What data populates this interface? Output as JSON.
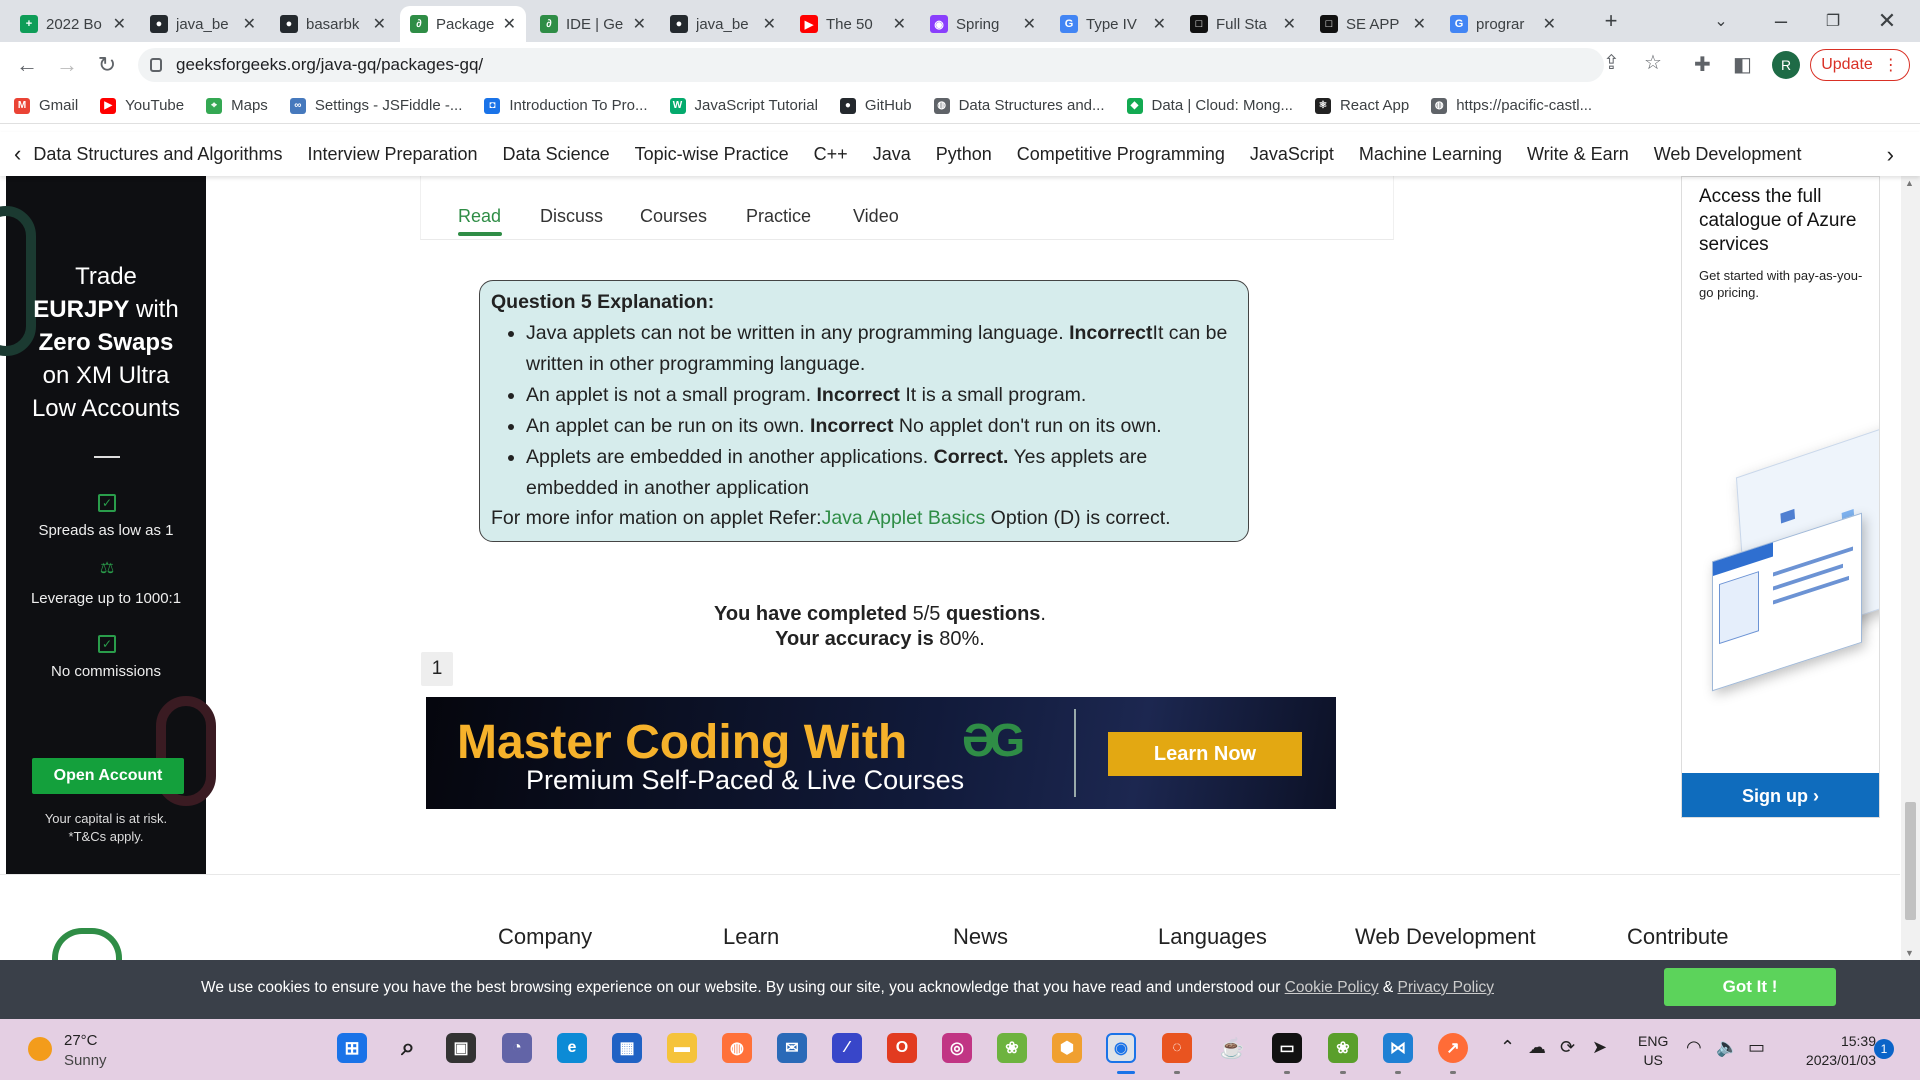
{
  "browser": {
    "tabs": [
      {
        "label": "2022 Bo",
        "icon": "sheets-icon",
        "color": "#0f9d58",
        "glyph": "+"
      },
      {
        "label": "java_be",
        "icon": "github-icon",
        "color": "#24292e",
        "glyph": "●"
      },
      {
        "label": "basarbk",
        "icon": "github-icon",
        "color": "#24292e",
        "glyph": "●"
      },
      {
        "label": "Package",
        "icon": "gfg-icon",
        "color": "#2f8d46",
        "glyph": "∂"
      },
      {
        "label": "IDE | Ge",
        "icon": "gfg-icon",
        "color": "#2f8d46",
        "glyph": "∂"
      },
      {
        "label": "java_be",
        "icon": "github-icon",
        "color": "#24292e",
        "glyph": "●"
      },
      {
        "label": "The 50",
        "icon": "youtube-icon",
        "color": "#ff0000",
        "glyph": "▶"
      },
      {
        "label": "Spring",
        "icon": "spring-icon",
        "color": "#8a3ffc",
        "glyph": "◉"
      },
      {
        "label": "Type IV",
        "icon": "google-icon",
        "color": "#4285f4",
        "glyph": "G"
      },
      {
        "label": "Full Sta",
        "icon": "app-icon",
        "color": "#111111",
        "glyph": "□"
      },
      {
        "label": "SE APP",
        "icon": "app-icon",
        "color": "#111111",
        "glyph": "□"
      },
      {
        "label": "prograr",
        "icon": "google-icon",
        "color": "#4285f4",
        "glyph": "G"
      }
    ],
    "active_tab_index": 3,
    "url": "geeksforgeeks.org/java-gq/packages-gq/",
    "update_label": "Update",
    "profile_initial": "R"
  },
  "bookmarks": [
    {
      "label": "Gmail",
      "icon": "gmail-icon",
      "color": "#ea4335",
      "glyph": "M"
    },
    {
      "label": "YouTube",
      "icon": "youtube-icon",
      "color": "#ff0000",
      "glyph": "▶"
    },
    {
      "label": "Maps",
      "icon": "maps-icon",
      "color": "#34a853",
      "glyph": "⌖"
    },
    {
      "label": "Settings - JSFiddle -...",
      "icon": "jsfiddle-icon",
      "color": "#4679bd",
      "glyph": "∞"
    },
    {
      "label": "Introduction To Pro...",
      "icon": "person-icon",
      "color": "#1a73e8",
      "glyph": "◘"
    },
    {
      "label": "JavaScript Tutorial",
      "icon": "w3schools-icon",
      "color": "#04aa6d",
      "glyph": "W"
    },
    {
      "label": "GitHub",
      "icon": "github-icon",
      "color": "#24292e",
      "glyph": "●"
    },
    {
      "label": "Data Structures and...",
      "icon": "globe-icon",
      "color": "#5f6368",
      "glyph": "◍"
    },
    {
      "label": "Data | Cloud: Mong...",
      "icon": "mongodb-icon",
      "color": "#13aa52",
      "glyph": "◆"
    },
    {
      "label": "React App",
      "icon": "react-icon",
      "color": "#222222",
      "glyph": "⚛"
    },
    {
      "label": "https://pacific-castl...",
      "icon": "globe-icon",
      "color": "#5f6368",
      "glyph": "◍"
    }
  ],
  "site_nav": [
    "Data Structures and Algorithms",
    "Interview Preparation",
    "Data Science",
    "Topic-wise Practice",
    "C++",
    "Java",
    "Python",
    "Competitive Programming",
    "JavaScript",
    "Machine Learning",
    "Write & Earn",
    "Web Development"
  ],
  "article_tabs": [
    "Read",
    "Discuss",
    "Courses",
    "Practice",
    "Video"
  ],
  "explanation": {
    "title": "Question 5 Explanation:",
    "items": [
      {
        "text": "Java applets can not be written in any programming language. ",
        "bold": "Incorrect",
        "after": "It can be written in other programming language."
      },
      {
        "text": "An applet is not a small program. ",
        "bold": "Incorrect",
        "after": " It is a small program."
      },
      {
        "text": "An applet can be run on its own. ",
        "bold": "Incorrect",
        "after": " No applet don't run on its own."
      },
      {
        "text": "Applets are embedded in another applications. ",
        "bold": "Correct.",
        "after": " Yes applets are embedded in another application"
      }
    ],
    "refer_prefix": "For more infor mation on applet Refer:",
    "refer_link": "Java Applet Basics",
    "refer_suffix": " Option (D) is correct."
  },
  "result": {
    "completed_label": "You have completed",
    "completed_value": "5/5",
    "questions_label": "questions",
    "accuracy_label": "Your accuracy is",
    "accuracy_value": "80%."
  },
  "pagination": {
    "page": "1"
  },
  "banner": {
    "headline": "Master Coding With",
    "subline": "Premium Self-Paced & Live Courses",
    "cta": "Learn Now"
  },
  "left_ad": {
    "line1": "Trade",
    "line2a": "EURJPY",
    "line2b": " with",
    "line3": "Zero Swaps",
    "line4": "on XM Ultra",
    "line5": "Low Accounts",
    "feature1": "Spreads as low as 1",
    "feature2": "Leverage up to 1000:1",
    "feature3": "No commissions",
    "cta": "Open Account",
    "risk1": "Your capital is at risk.",
    "risk2": "*T&Cs apply."
  },
  "right_ad": {
    "headline": "Access the full catalogue of Azure services",
    "sub": "Get started with pay-as-you-go pricing.",
    "cta": "Sign up ›"
  },
  "footer_peek": [
    "Company",
    "Learn",
    "News",
    "Languages",
    "Web Development",
    "Contribute"
  ],
  "cookie": {
    "text": "We use cookies to ensure you have the best browsing experience on our website. By using our site, you acknowledge that you have read and understood our ",
    "policy1": "Cookie Policy",
    "amp": " & ",
    "policy2": "Privacy Policy",
    "button": "Got It !"
  },
  "taskbar": {
    "temperature": "27°C",
    "condition": "Sunny",
    "language": "ENG",
    "region": "US",
    "time": "15:39",
    "date": "2023/01/03",
    "notifications": "1"
  }
}
